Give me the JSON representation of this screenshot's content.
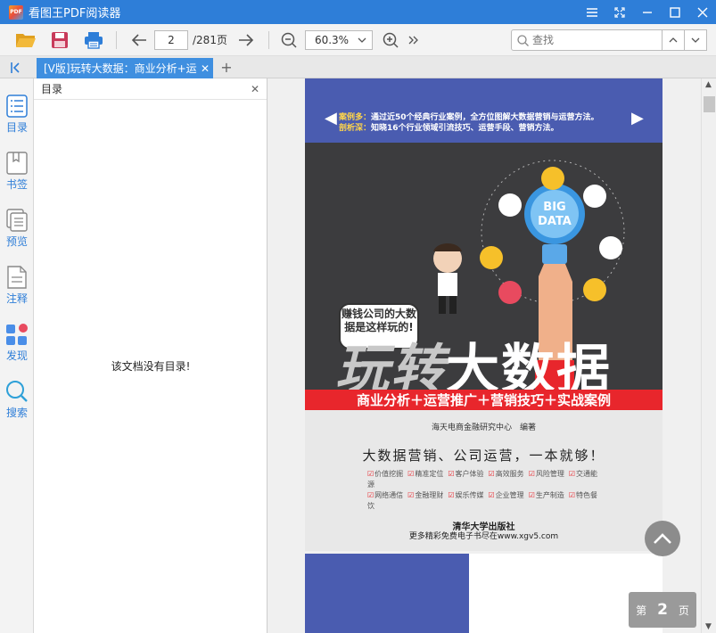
{
  "window": {
    "title": "看图王PDF阅读器",
    "logo_text": "PDF",
    "controls": [
      "menu-icon",
      "fullscreen-icon",
      "minimize-icon",
      "maximize-icon",
      "close-icon"
    ]
  },
  "toolbar": {
    "current_page": "2",
    "total_pages": "/281页",
    "zoom": "60.3%",
    "search_placeholder": "查找"
  },
  "tabs": [
    {
      "title": "[V版]玩转大数据：商业分析+运营推广+营销技巧+实战案例"
    }
  ],
  "sidebar": {
    "items": [
      {
        "label": "目录",
        "icon": "outline-icon"
      },
      {
        "label": "书签",
        "icon": "bookmark-icon"
      },
      {
        "label": "预览",
        "icon": "thumbnail-icon"
      },
      {
        "label": "注释",
        "icon": "annotation-icon"
      },
      {
        "label": "发现",
        "icon": "discover-icon"
      },
      {
        "label": "搜索",
        "icon": "search-icon"
      }
    ]
  },
  "outline_panel": {
    "title": "目录",
    "empty_message": "该文档没有目录!"
  },
  "cover": {
    "line1_key": "案例多：",
    "line1": "通过近50个经典行业案例，全方位图解大数据营销与运营方法。",
    "line2_key": "剖析深：",
    "line2": "知晓16个行业领域引流技巧、运营手段、营销方法。",
    "bubble": "赚钱公司的大数据是这样玩的!",
    "title_part1": "玩转",
    "title_part2": "大数据",
    "band": "商业分析＋运营推广＋营销技巧＋实战案例",
    "author": "海天电商金融研究中心　编著",
    "slogan": "大数据营销、公司运营，一本就够！",
    "tags": [
      "价值挖掘",
      "精准定位",
      "客户体验",
      "高效服务",
      "风险管理",
      "交通能源",
      "网络通信",
      "金融理财",
      "娱乐传媒",
      "企业管理",
      "生产制造",
      "特色餐饮"
    ],
    "publisher": "清华大学出版社",
    "watermark": "更多精彩免费电子书尽在www.xgv5.com"
  },
  "page_indicator": {
    "prefix": "第",
    "number": "2",
    "suffix": "页"
  }
}
